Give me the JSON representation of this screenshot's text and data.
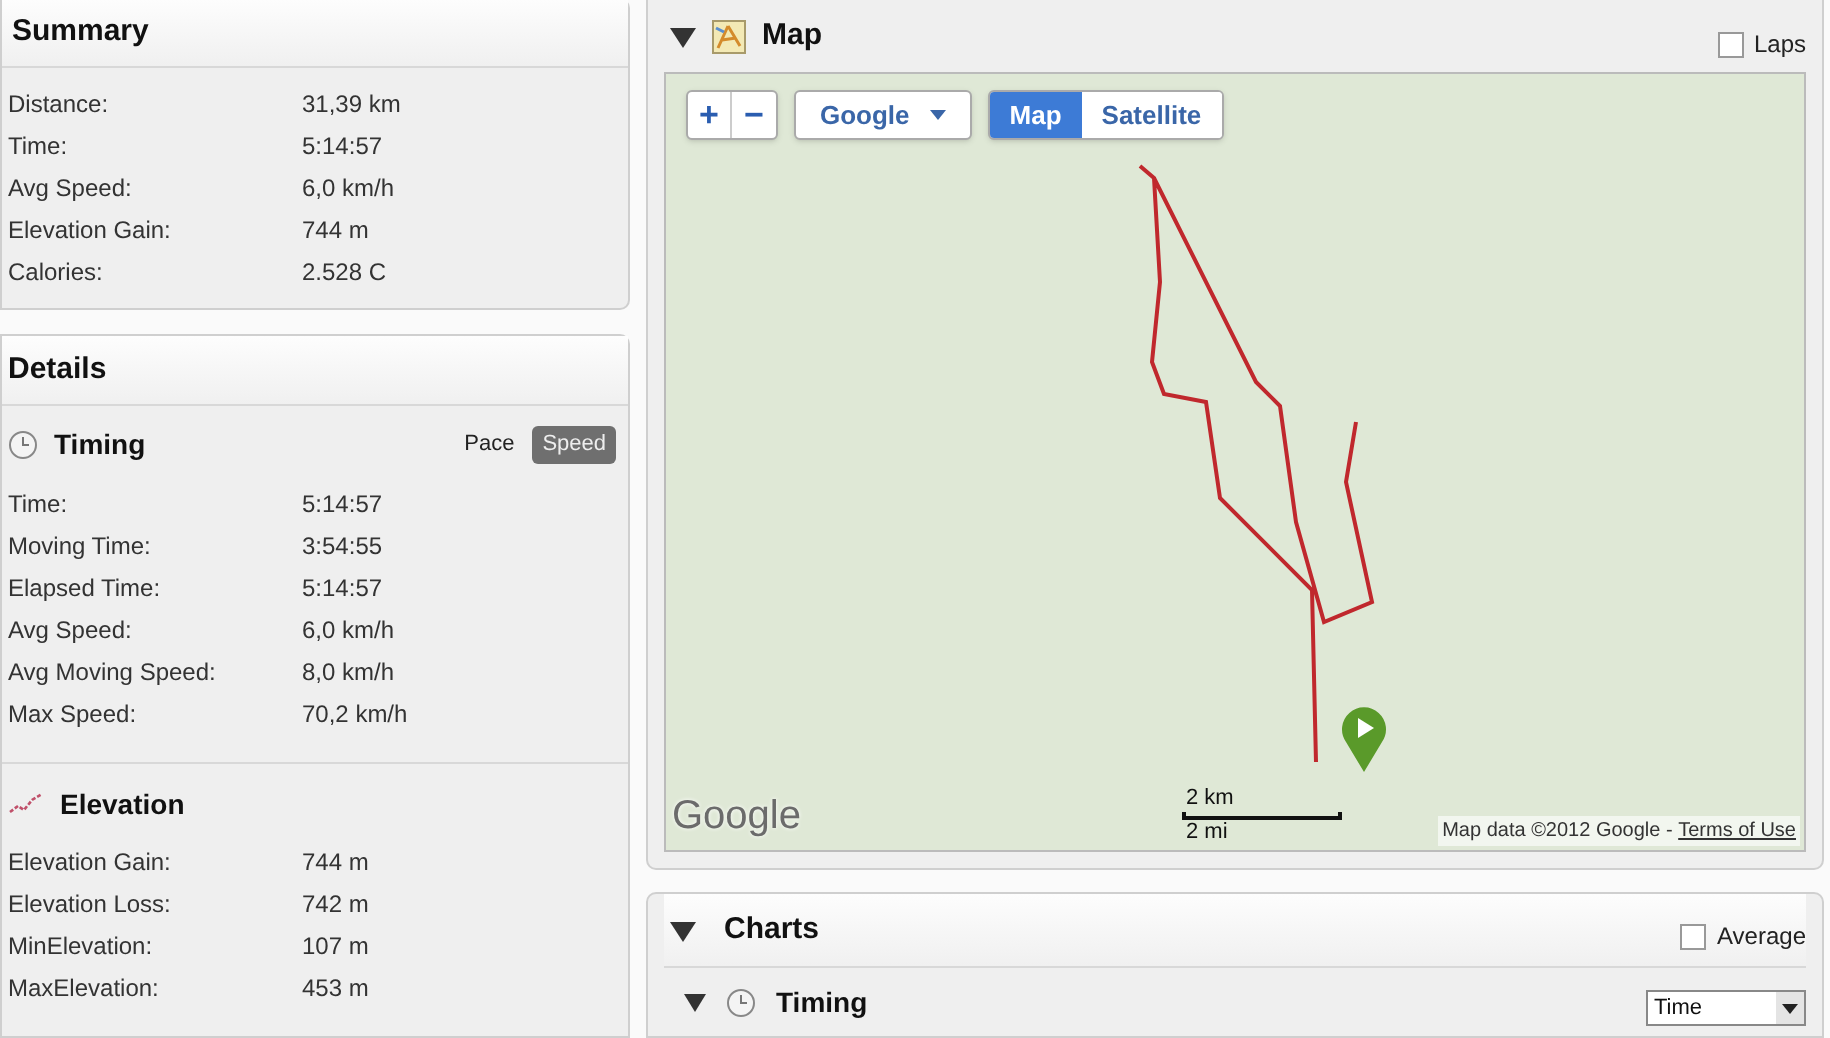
{
  "summary": {
    "title": "Summary",
    "rows": [
      {
        "label": "Distance:",
        "value": "31,39 km"
      },
      {
        "label": "Time:",
        "value": "5:14:57"
      },
      {
        "label": "Avg Speed:",
        "value": "6,0 km/h"
      },
      {
        "label": "Elevation Gain:",
        "value": "744 m"
      },
      {
        "label": "Calories:",
        "value": "2.528 C"
      }
    ]
  },
  "details": {
    "title": "Details",
    "sections": [
      {
        "kind": "timing",
        "title": "Timing",
        "toggle": [
          {
            "label": "Pace",
            "selected": false
          },
          {
            "label": "Speed",
            "selected": true
          }
        ],
        "rows": [
          {
            "label": "Time:",
            "value": "5:14:57"
          },
          {
            "label": "Moving Time:",
            "value": "3:54:55"
          },
          {
            "label": "Elapsed Time:",
            "value": "5:14:57"
          },
          {
            "label": "Avg Speed:",
            "value": "6,0 km/h"
          },
          {
            "label": "Avg Moving Speed:",
            "value": "8,0 km/h"
          },
          {
            "label": "Max Speed:",
            "value": "70,2 km/h"
          }
        ]
      },
      {
        "kind": "elevation",
        "title": "Elevation",
        "rows": [
          {
            "label": "Elevation Gain:",
            "value": "744 m"
          },
          {
            "label": "Elevation Loss:",
            "value": "742 m"
          },
          {
            "label": "MinElevation:",
            "value": "107 m"
          },
          {
            "label": "MaxElevation:",
            "value": "453 m"
          }
        ]
      }
    ]
  },
  "map": {
    "title": "Map",
    "expanded": true,
    "laps": {
      "label": "Laps",
      "checked": false
    },
    "zoom_in": "+",
    "zoom_out": "−",
    "provider": "Google",
    "map_types": [
      {
        "label": "Map",
        "selected": true
      },
      {
        "label": "Satellite",
        "selected": false
      }
    ],
    "scale": [
      "2 km",
      "2 mi"
    ],
    "logo": "Google",
    "attribution": "Map data ©2012 Google - ",
    "terms_link": "Terms of Use"
  },
  "charts": {
    "title": "Charts",
    "expanded": true,
    "average": {
      "label": "Average",
      "checked": false
    },
    "sections": [
      {
        "kind": "timing",
        "title": "Timing",
        "expanded": true,
        "axis_select": "Time"
      }
    ]
  }
}
